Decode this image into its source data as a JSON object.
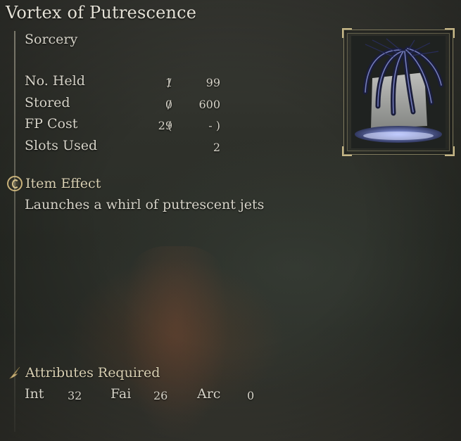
{
  "item": {
    "name": "Vortex of Putrescence",
    "type": "Sorcery",
    "stats": [
      {
        "label": "No. Held",
        "value": "1",
        "sep": "/",
        "max": "99"
      },
      {
        "label": "Stored",
        "value": "0",
        "sep": "/",
        "max": "600"
      },
      {
        "label": "FP Cost",
        "value": "29",
        "sep": "(",
        "max": "- )"
      },
      {
        "label": "Slots Used",
        "value": "",
        "sep": "",
        "max": "2"
      }
    ],
    "effect": {
      "heading": "Item Effect",
      "text": "Launches a whirl of putrescent jets"
    },
    "attributes": {
      "heading": "Attributes Required",
      "int_label": "Int",
      "int_value": "32",
      "fai_label": "Fai",
      "fai_value": "26",
      "arc_label": "Arc",
      "arc_value": "0"
    },
    "icons": {
      "effect": "item-effect-icon",
      "attributes": "attributes-feather-icon",
      "art": "sorcery-artwork"
    }
  }
}
